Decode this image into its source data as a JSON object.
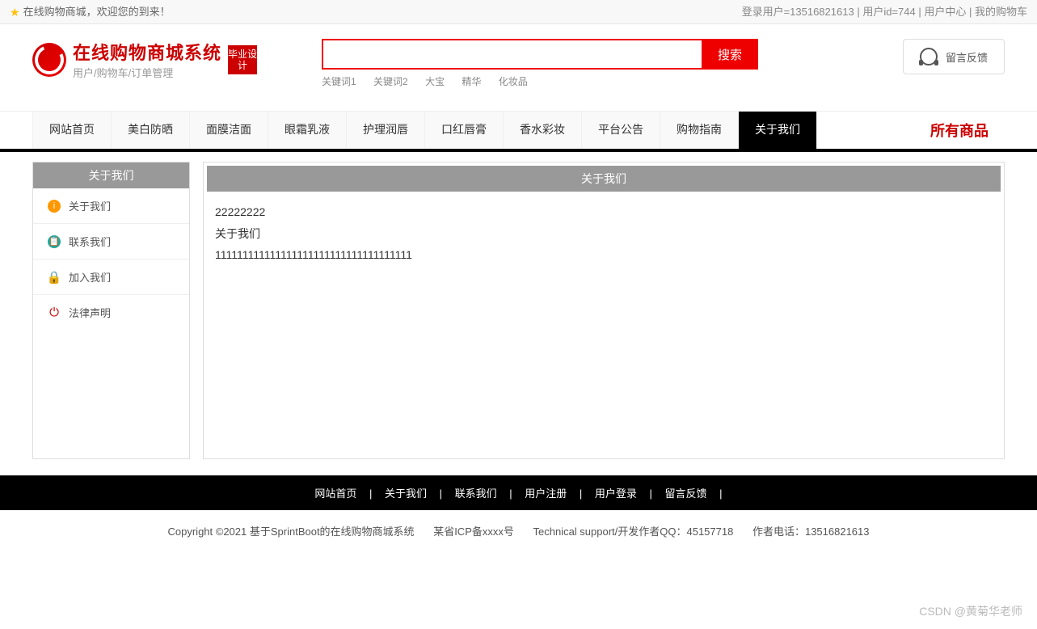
{
  "topbar": {
    "welcome": "在线购物商城，欢迎您的到来！",
    "login_user_label": "登录用户=13516821613",
    "user_id_label": "用户id=744",
    "user_center": "用户中心",
    "my_cart": "我的购物车"
  },
  "logo": {
    "title": "在线购物商城系统",
    "subtitle": "用户/购物车/订单管理",
    "badge": "毕业设计"
  },
  "search": {
    "button": "搜索",
    "placeholder": "",
    "keywords": [
      "关键词1",
      "关键词2",
      "大宝",
      "精华",
      "化妆品"
    ]
  },
  "feedback": {
    "label": "留言反馈"
  },
  "nav": {
    "items": [
      "网站首页",
      "美白防晒",
      "面膜洁面",
      "眼霜乳液",
      "护理润唇",
      "口红唇膏",
      "香水彩妆",
      "平台公告",
      "购物指南",
      "关于我们"
    ],
    "active_index": 9,
    "all_products": "所有商品"
  },
  "sidebar": {
    "title": "关于我们",
    "items": [
      {
        "label": "关于我们",
        "icon": "info"
      },
      {
        "label": "联系我们",
        "icon": "clipboard"
      },
      {
        "label": "加入我们",
        "icon": "lock"
      },
      {
        "label": "法律声明",
        "icon": "power"
      }
    ]
  },
  "content": {
    "title": "关于我们",
    "line1": "22222222",
    "line2": "关于我们",
    "line3": "111111111111111111111111111111111111"
  },
  "footer_nav": {
    "items": [
      "网站首页",
      "关于我们",
      "联系我们",
      "用户注册",
      "用户登录",
      "留言反馈"
    ]
  },
  "footer_copy": {
    "copyright": "Copyright ©2021 基于SprintBoot的在线购物商城系统",
    "icp": "某省ICP备xxxx号",
    "tech": "Technical support/开发作者QQ：45157718",
    "phone": "作者电话：13516821613"
  },
  "watermark": "CSDN @黄菊华老师"
}
